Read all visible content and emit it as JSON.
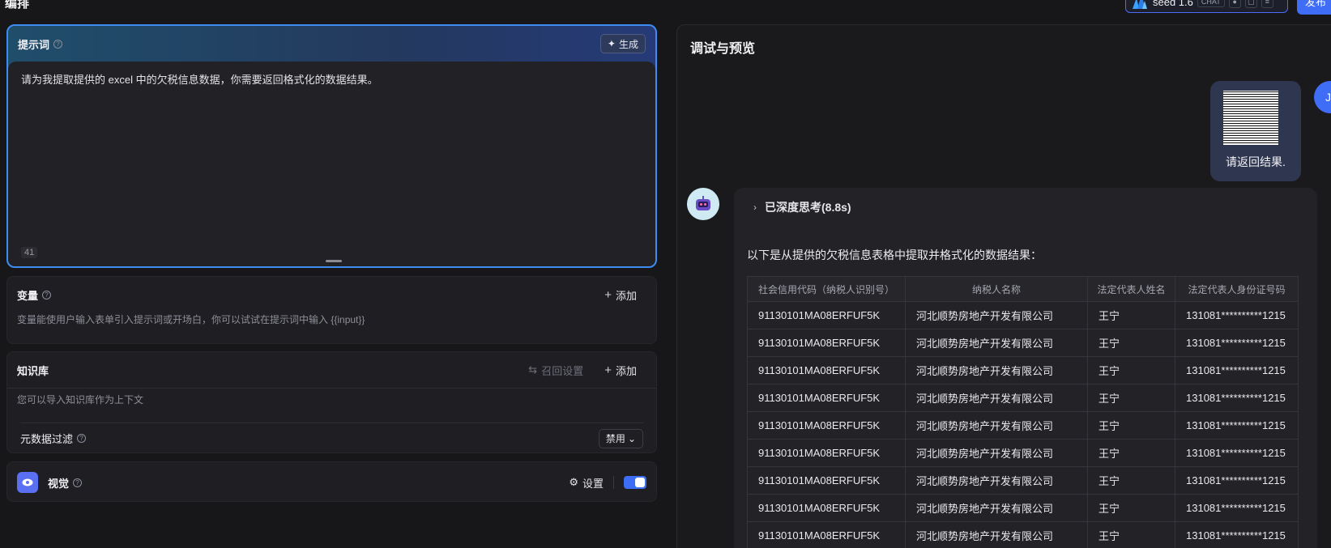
{
  "header": {
    "title": "编排",
    "model_name": "seed 1.6",
    "model_badge": "CHAT",
    "publish_label": "发布"
  },
  "prompt": {
    "title": "提示词",
    "generate_label": "生成",
    "text": "请为我提取提供的 excel 中的欠税信息数据，你需要返回格式化的数据结果。",
    "char_count": "41"
  },
  "variables": {
    "title": "变量",
    "add_label": "添加",
    "description": "变量能使用户输入表单引入提示词或开场白，你可以试试在提示词中输入 {{input}}"
  },
  "knowledge": {
    "title": "知识库",
    "recall_label": "召回设置",
    "add_label": "添加",
    "description": "您可以导入知识库作为上下文",
    "metadata_filter_label": "元数据过滤",
    "metadata_filter_value": "禁用"
  },
  "vision": {
    "title": "视觉",
    "settings_label": "设置",
    "enabled": true
  },
  "preview": {
    "title": "调试与预览",
    "user_avatar_initial": "J",
    "user_message": "请返回结果.",
    "thinking_label": "已深度思考(8.8s)",
    "answer_intro": "以下是从提供的欠税信息表格中提取并格式化的数据结果：",
    "table": {
      "headers": [
        "社会信用代码（纳税人识别号）",
        "纳税人名称",
        "法定代表人姓名",
        "法定代表人身份证号码"
      ],
      "rows": [
        [
          "91130101MA08ERFUF5K",
          "河北顺势房地产开发有限公司",
          "王宁",
          "131081**********1215"
        ],
        [
          "91130101MA08ERFUF5K",
          "河北顺势房地产开发有限公司",
          "王宁",
          "131081**********1215"
        ],
        [
          "91130101MA08ERFUF5K",
          "河北顺势房地产开发有限公司",
          "王宁",
          "131081**********1215"
        ],
        [
          "91130101MA08ERFUF5K",
          "河北顺势房地产开发有限公司",
          "王宁",
          "131081**********1215"
        ],
        [
          "91130101MA08ERFUF5K",
          "河北顺势房地产开发有限公司",
          "王宁",
          "131081**********1215"
        ],
        [
          "91130101MA08ERFUF5K",
          "河北顺势房地产开发有限公司",
          "王宁",
          "131081**********1215"
        ],
        [
          "91130101MA08ERFUF5K",
          "河北顺势房地产开发有限公司",
          "王宁",
          "131081**********1215"
        ],
        [
          "91130101MA08ERFUF5K",
          "河北顺势房地产开发有限公司",
          "王宁",
          "131081**********1215"
        ],
        [
          "91130101MA08ERFUF5K",
          "河北顺势房地产开发有限公司",
          "王宁",
          "131081**********1215"
        ]
      ]
    }
  },
  "colors": {
    "accent": "#3f6df6",
    "prompt_border": "#3f8cf0",
    "background": "#17171a"
  }
}
